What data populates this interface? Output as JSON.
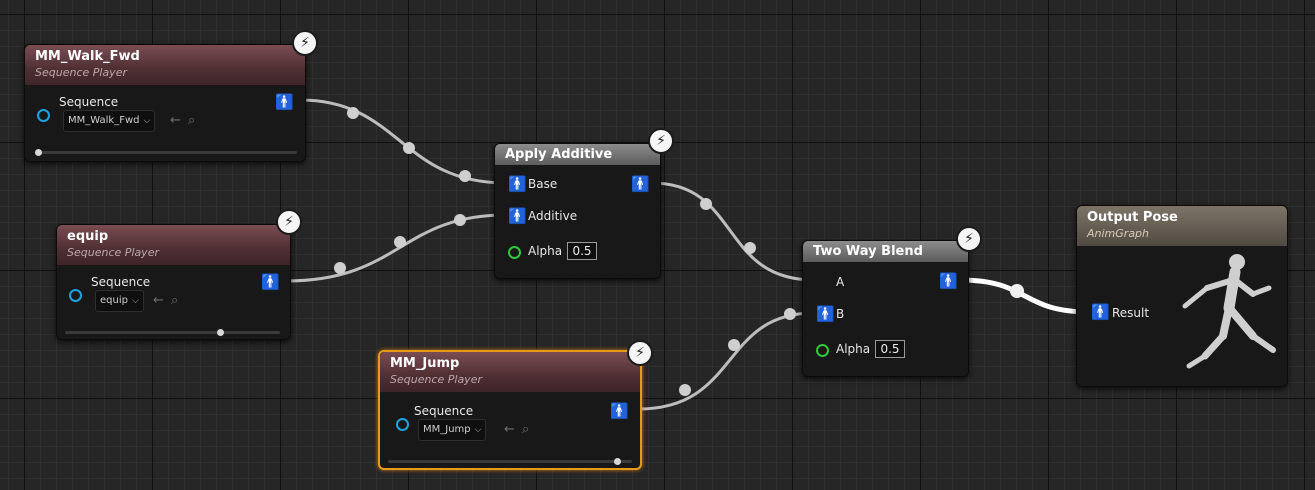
{
  "nodes": {
    "walk": {
      "title": "MM_Walk_Fwd",
      "subtitle": "Sequence Player",
      "pin_label": "Sequence",
      "combo_value": "MM_Walk_Fwd",
      "slider_fraction": 0.0
    },
    "equip": {
      "title": "equip",
      "subtitle": "Sequence Player",
      "pin_label": "Sequence",
      "combo_value": "equip",
      "slider_fraction": 0.7
    },
    "jump": {
      "title": "MM_Jump",
      "subtitle": "Sequence Player",
      "pin_label": "Sequence",
      "combo_value": "MM_Jump",
      "slider_fraction": 0.93
    },
    "apply_additive": {
      "title": "Apply Additive",
      "pin_base": "Base",
      "pin_additive": "Additive",
      "alpha_label": "Alpha",
      "alpha_value": "0.5"
    },
    "two_way_blend": {
      "title": "Two Way Blend",
      "pin_a": "A",
      "pin_b": "B",
      "alpha_label": "Alpha",
      "alpha_value": "0.5"
    },
    "output_pose": {
      "title": "Output Pose",
      "subtitle": "AnimGraph",
      "pin_result": "Result"
    }
  },
  "icons": {
    "fast_path": "lightning-bolt-icon",
    "pose_pin": "mannequin-pose-icon",
    "exec_pin": "sequence-pin-icon",
    "browse": "browse-back-icon",
    "find": "search-icon"
  },
  "colors": {
    "selection": "#e89a1c",
    "sequence_pin": "#1fa3e0",
    "alpha_pin": "#2fc93a"
  }
}
